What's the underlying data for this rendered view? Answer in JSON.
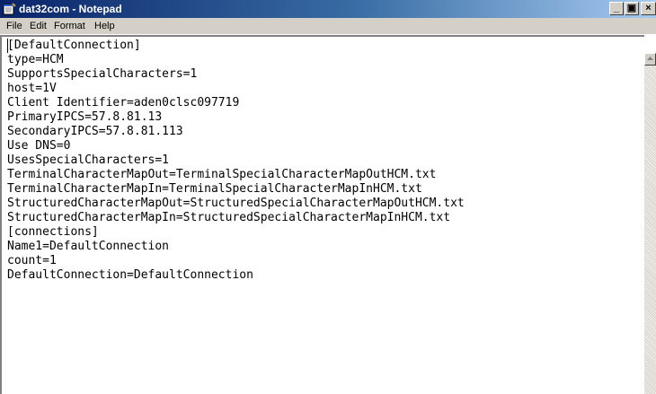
{
  "window": {
    "title": "dat32com - Notepad",
    "minimize_glyph": "_",
    "maximize_glyph": "▣",
    "close_glyph": "×",
    "icon": "notepad-icon"
  },
  "menu": {
    "items": [
      "File",
      "Edit",
      "Format",
      "Help"
    ]
  },
  "document": {
    "lines": [
      "[DefaultConnection]",
      "type=HCM",
      "SupportsSpecialCharacters=1",
      "host=1V",
      "Client Identifier=aden0clsc097719",
      "PrimaryIPCS=57.8.81.13",
      "SecondaryIPCS=57.8.81.113",
      "Use DNS=0",
      "UsesSpecialCharacters=1",
      "TerminalCharacterMapOut=TerminalSpecialCharacterMapOutHCM.txt",
      "TerminalCharacterMapIn=TerminalSpecialCharacterMapInHCM.txt",
      "StructuredCharacterMapOut=StructuredSpecialCharacterMapOutHCM.txt",
      "StructuredCharacterMapIn=StructuredSpecialCharacterMapInHCM.txt",
      "[connections]",
      "Name1=DefaultConnection",
      "count=1",
      "DefaultConnection=DefaultConnection"
    ]
  },
  "colors": {
    "titlebar_start": "#0a246a",
    "titlebar_end": "#a6caf0",
    "chrome": "#d4d0c8"
  }
}
